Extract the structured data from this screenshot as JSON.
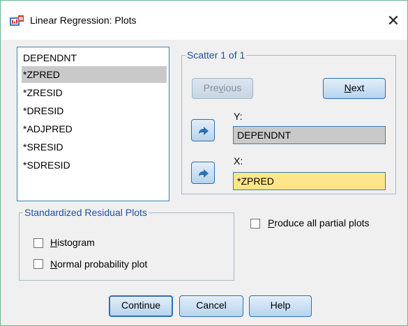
{
  "window": {
    "title": "Linear Regression: Plots",
    "close_glyph": "✕",
    "app_icon": "spss-dialog-icon"
  },
  "variables": [
    "DEPENDNT",
    "*ZPRED",
    "*ZRESID",
    "*DRESID",
    "*ADJPRED",
    "*SRESID",
    "*SDRESID"
  ],
  "selected_variable": "*ZPRED",
  "scatter": {
    "legend": "Scatter 1 of 1",
    "previous_label": "Previous",
    "previous_mnemonic": "v",
    "next_label": "Next",
    "next_mnemonic": "N",
    "y_label": "Y:",
    "y_value": "DEPENDNT",
    "x_label": "X:",
    "x_value": "*ZPRED",
    "arrow_icon": "move-right-arrow-icon"
  },
  "standardized": {
    "legend": "Standardized Residual Plots",
    "histogram_label": "Histogram",
    "histogram_checked": false,
    "normal_label": "Normal probability plot",
    "normal_checked": false
  },
  "partial": {
    "label": "Produce all partial plots",
    "checked": false
  },
  "buttons": {
    "continue": "Continue",
    "cancel": "Cancel",
    "help": "Help"
  },
  "colors": {
    "window_border": "#6fb58e",
    "selection": "#c9c9c9",
    "x_field": "#fde58a",
    "button_border": "#2d6fb0"
  }
}
